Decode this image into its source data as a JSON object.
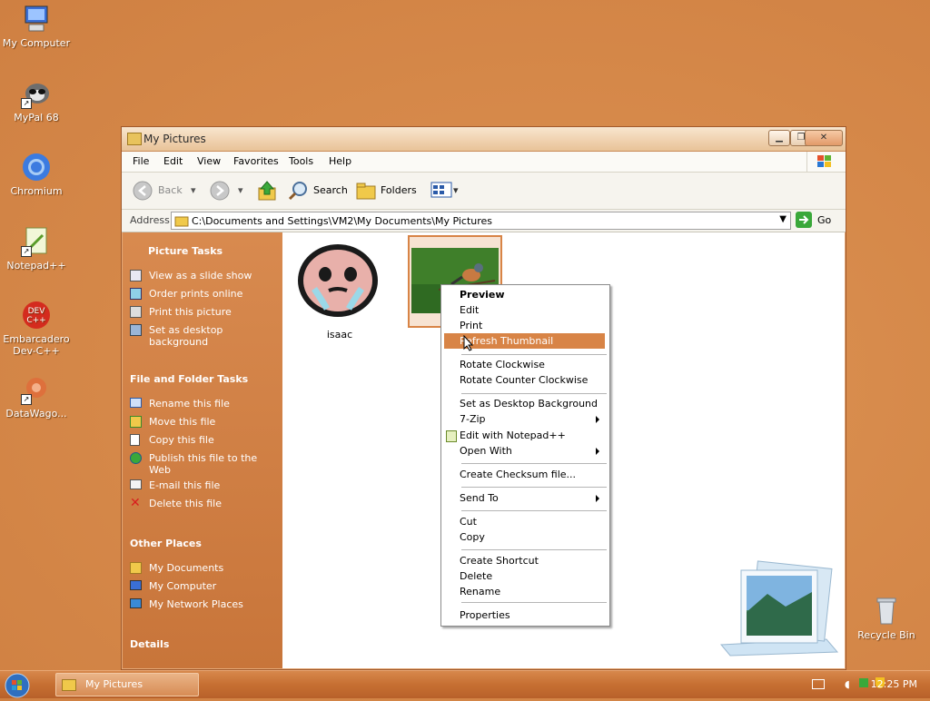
{
  "desktop": {
    "icons": [
      {
        "label": "My Computer"
      },
      {
        "label": "MyPal 68"
      },
      {
        "label": "Chromium"
      },
      {
        "label": "Notepad++"
      },
      {
        "label": "Embarcadero Dev-C++"
      },
      {
        "label": "DataWago..."
      },
      {
        "label": "Recycle Bin"
      }
    ]
  },
  "window": {
    "title": "My Pictures",
    "menu": [
      "File",
      "Edit",
      "View",
      "Favorites",
      "Tools",
      "Help"
    ],
    "toolbar": {
      "back": "Back",
      "search": "Search",
      "folders": "Folders"
    },
    "address": {
      "label": "Address",
      "value": "C:\\Documents and Settings\\VM2\\My Documents\\My Pictures",
      "go": "Go"
    }
  },
  "tasks": {
    "picture_tasks": {
      "title": "Picture Tasks",
      "items": [
        "View as a slide show",
        "Order prints online",
        "Print this picture",
        "Set as desktop background"
      ]
    },
    "file_tasks": {
      "title": "File and Folder Tasks",
      "items": [
        "Rename this file",
        "Move this file",
        "Copy this file",
        "Publish this file to the Web",
        "E-mail this file",
        "Delete this file"
      ]
    },
    "other_places": {
      "title": "Other Places",
      "items": [
        "My Documents",
        "My Computer",
        "My Network Places"
      ]
    },
    "details": {
      "title": "Details"
    }
  },
  "files": [
    {
      "name": "isaac"
    },
    {
      "name": ""
    }
  ],
  "context_menu": {
    "items": [
      {
        "label": "Preview",
        "bold": true
      },
      {
        "label": "Edit"
      },
      {
        "label": "Print"
      },
      {
        "label": "Refresh Thumbnail",
        "highlighted": true
      },
      {
        "label": "Rotate Clockwise"
      },
      {
        "label": "Rotate Counter Clockwise"
      },
      {
        "label": "Set as Desktop Background"
      },
      {
        "label": "7-Zip",
        "submenu": true
      },
      {
        "label": "Edit with Notepad++"
      },
      {
        "label": "Open With",
        "submenu": true
      },
      {
        "label": "Create Checksum file..."
      },
      {
        "label": "Send To",
        "submenu": true
      },
      {
        "label": "Cut"
      },
      {
        "label": "Copy"
      },
      {
        "label": "Create Shortcut"
      },
      {
        "label": "Delete"
      },
      {
        "label": "Rename"
      },
      {
        "label": "Properties"
      }
    ]
  },
  "taskbar": {
    "active_window": "My Pictures",
    "clock": "12:25 PM"
  },
  "colors": {
    "accent": "#d88446",
    "desktop": "#d6894a"
  }
}
